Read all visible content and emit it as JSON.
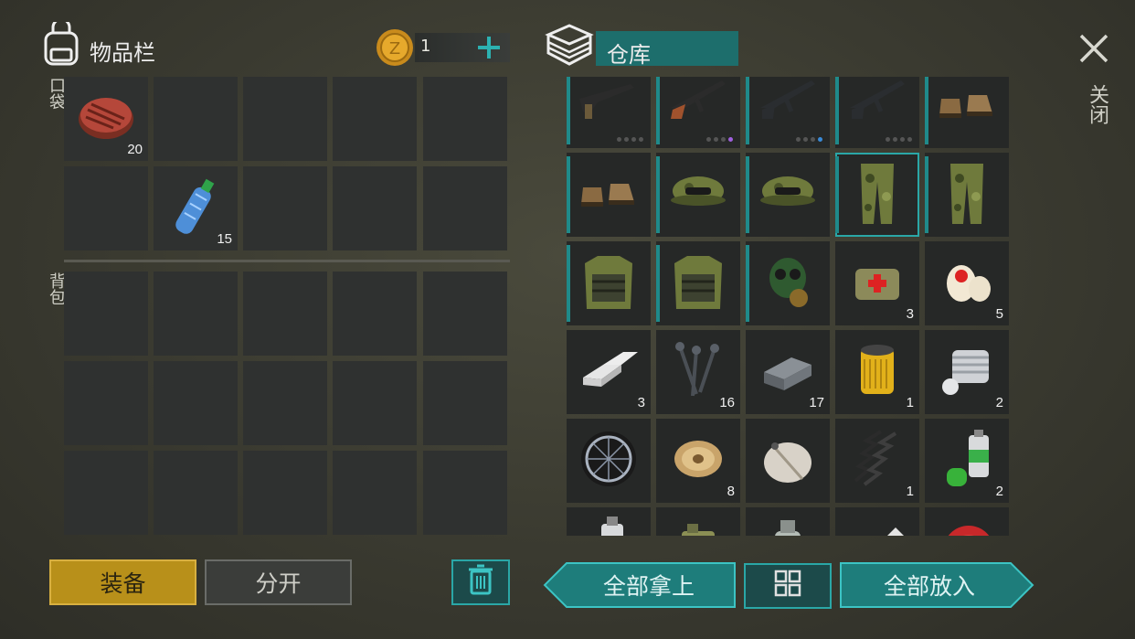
{
  "inventory": {
    "title": "物品栏",
    "coins": "1",
    "pocket_label": "口袋",
    "backpack_label": "背包",
    "pocket_items": [
      {
        "name": "steak",
        "count": "20"
      },
      {
        "name": "water-bottle",
        "count": "15"
      }
    ]
  },
  "storage": {
    "title": "仓库",
    "close_label": "关闭",
    "items": [
      {
        "name": "rifle",
        "count": ""
      },
      {
        "name": "ak-rifle",
        "count": ""
      },
      {
        "name": "m4-rifle",
        "count": ""
      },
      {
        "name": "m4-rifle",
        "count": ""
      },
      {
        "name": "boots",
        "count": ""
      },
      {
        "name": "boots",
        "count": ""
      },
      {
        "name": "camo-cap",
        "count": ""
      },
      {
        "name": "camo-cap",
        "count": ""
      },
      {
        "name": "camo-pants",
        "count": ""
      },
      {
        "name": "camo-pants",
        "count": ""
      },
      {
        "name": "camo-vest",
        "count": ""
      },
      {
        "name": "camo-vest",
        "count": ""
      },
      {
        "name": "gas-mask",
        "count": ""
      },
      {
        "name": "medkit-bag",
        "count": "3"
      },
      {
        "name": "bandage",
        "count": "5"
      },
      {
        "name": "aluminum-ingot",
        "count": "3"
      },
      {
        "name": "nails",
        "count": "16"
      },
      {
        "name": "iron-ingot",
        "count": "17"
      },
      {
        "name": "oil-filter",
        "count": "1"
      },
      {
        "name": "engine-cylinder",
        "count": "2"
      },
      {
        "name": "wheel",
        "count": ""
      },
      {
        "name": "wire-spool",
        "count": "8"
      },
      {
        "name": "satellite-dish",
        "count": ""
      },
      {
        "name": "spring",
        "count": "1"
      },
      {
        "name": "spray-paint-green",
        "count": "2"
      },
      {
        "name": "spray-paint-blue",
        "count": ""
      },
      {
        "name": "jerry-can",
        "count": ""
      },
      {
        "name": "glass-jar",
        "count": ""
      },
      {
        "name": "magazine-roll",
        "count": ""
      },
      {
        "name": "bottle-cap",
        "count": ""
      }
    ]
  },
  "buttons": {
    "equip": "装备",
    "split": "分开",
    "take_all": "全部拿上",
    "put_all": "全部放入"
  },
  "colors": {
    "teal": "#1f8a8a",
    "gold": "#b8901a"
  }
}
